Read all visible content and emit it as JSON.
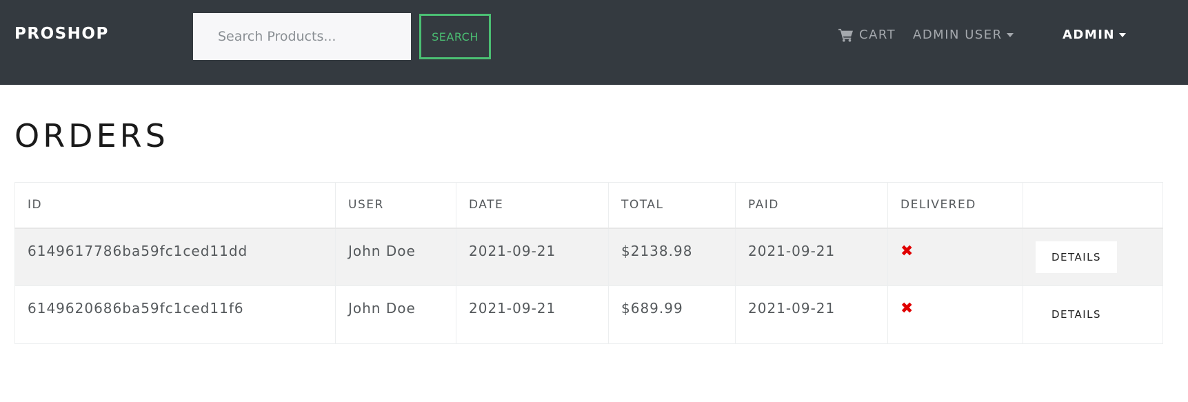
{
  "navbar": {
    "brand": "PROSHOP",
    "search_placeholder": "Search Products...",
    "search_label": "SEARCH",
    "cart_label": "CART",
    "user_menu_label": "ADMIN USER",
    "admin_menu_label": "ADMIN"
  },
  "page": {
    "title": "ORDERS"
  },
  "table": {
    "headers": [
      "ID",
      "USER",
      "DATE",
      "TOTAL",
      "PAID",
      "DELIVERED",
      ""
    ],
    "rows": [
      {
        "id": "6149617786ba59fc1ced11dd",
        "user": "John Doe",
        "date": "2021-09-21",
        "total": "$2138.98",
        "paid": "2021-09-21",
        "delivered_icon": "x-icon",
        "action": "DETAILS"
      },
      {
        "id": "6149620686ba59fc1ced11f6",
        "user": "John Doe",
        "date": "2021-09-21",
        "total": "$689.99",
        "paid": "2021-09-21",
        "delivered_icon": "x-icon",
        "action": "DETAILS"
      }
    ]
  },
  "colors": {
    "navbar_bg": "#343a40",
    "accent_green": "#4bbf73",
    "not_delivered_red": "#e00000"
  }
}
